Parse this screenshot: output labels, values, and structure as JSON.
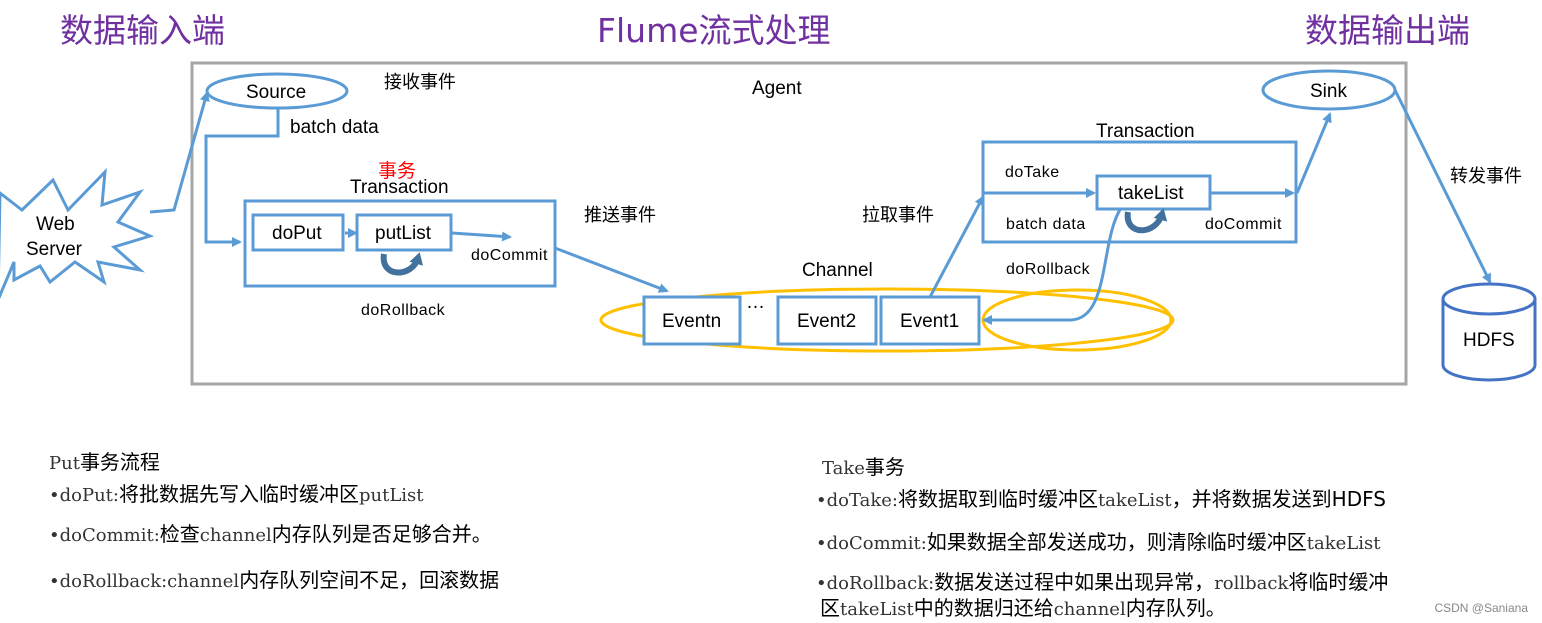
{
  "titles": {
    "input": "数据输入端",
    "main": "Flume流式处理",
    "output": "数据输出端"
  },
  "colors": {
    "title": "#7030a0",
    "flow": "#5b9bd5",
    "loop": "#41719c",
    "channel": "#ffc000",
    "agent_border": "#a6a6a6",
    "accent_red": "#ff0000"
  },
  "nodes": {
    "web_server": [
      "Web",
      "Server"
    ],
    "source": "Source",
    "sink": "Sink",
    "hdfs": "HDFS",
    "agent": "Agent",
    "channel": "Channel",
    "put_transaction": {
      "title_cn": "事务",
      "title": "Transaction",
      "do_put": "doPut",
      "put_list": "putList",
      "do_commit": "doCommit",
      "do_rollback": "doRollback"
    },
    "take_transaction": {
      "title": "Transaction",
      "do_take": "doTake",
      "take_list": "takeList",
      "batch_data": "batch data",
      "do_commit": "doCommit",
      "do_rollback": "doRollback"
    },
    "events": [
      "Eventn",
      "…",
      "Event2",
      "Event1"
    ]
  },
  "edge_labels": {
    "receive": "接收事件",
    "batch_data": "batch data",
    "push": "推送事件",
    "pull": "拉取事件",
    "forward": "转发事件"
  },
  "notes": {
    "put": {
      "heading": [
        {
          "t": "Put",
          "m": true
        },
        {
          "t": "事务流程",
          "m": false
        }
      ],
      "items": [
        [
          {
            "t": "•doPut:",
            "m": true
          },
          {
            "t": "将批数据先写入临时缓冲区",
            "m": false
          },
          {
            "t": "putList",
            "m": true
          }
        ],
        [
          {
            "t": "•doCommit:",
            "m": true
          },
          {
            "t": "检查",
            "m": false
          },
          {
            "t": "channel",
            "m": true
          },
          {
            "t": "内存队列是否足够合并。",
            "m": false
          }
        ],
        [
          {
            "t": "•doRollback:channel",
            "m": true
          },
          {
            "t": "内存队列空间不足，回滚数据",
            "m": false
          }
        ]
      ]
    },
    "take": {
      "heading": [
        {
          "t": "Take",
          "m": true
        },
        {
          "t": "事务",
          "m": false
        }
      ],
      "items": [
        [
          {
            "t": "•doTake:",
            "m": true
          },
          {
            "t": "将数据取到临时缓冲区",
            "m": false
          },
          {
            "t": "takeList",
            "m": true
          },
          {
            "t": "，并将数据发送到HDFS",
            "m": false
          }
        ],
        [
          {
            "t": "•doCommit:",
            "m": true
          },
          {
            "t": "如果数据全部发送成功，则清除临时缓冲区",
            "m": false
          },
          {
            "t": "takeList",
            "m": true
          }
        ],
        [
          {
            "t": "•doRollback:",
            "m": true
          },
          {
            "t": "数据发送过程中如果出现异常，",
            "m": false
          },
          {
            "t": "rollback",
            "m": true
          },
          {
            "t": "将临时缓冲",
            "m": false
          }
        ],
        [
          {
            "t": "区",
            "m": false
          },
          {
            "t": "takeList",
            "m": true
          },
          {
            "t": "中的数据归还给",
            "m": false
          },
          {
            "t": "channel",
            "m": true
          },
          {
            "t": "内存队列。",
            "m": false
          }
        ]
      ]
    }
  },
  "watermark": "CSDN @Saniana"
}
